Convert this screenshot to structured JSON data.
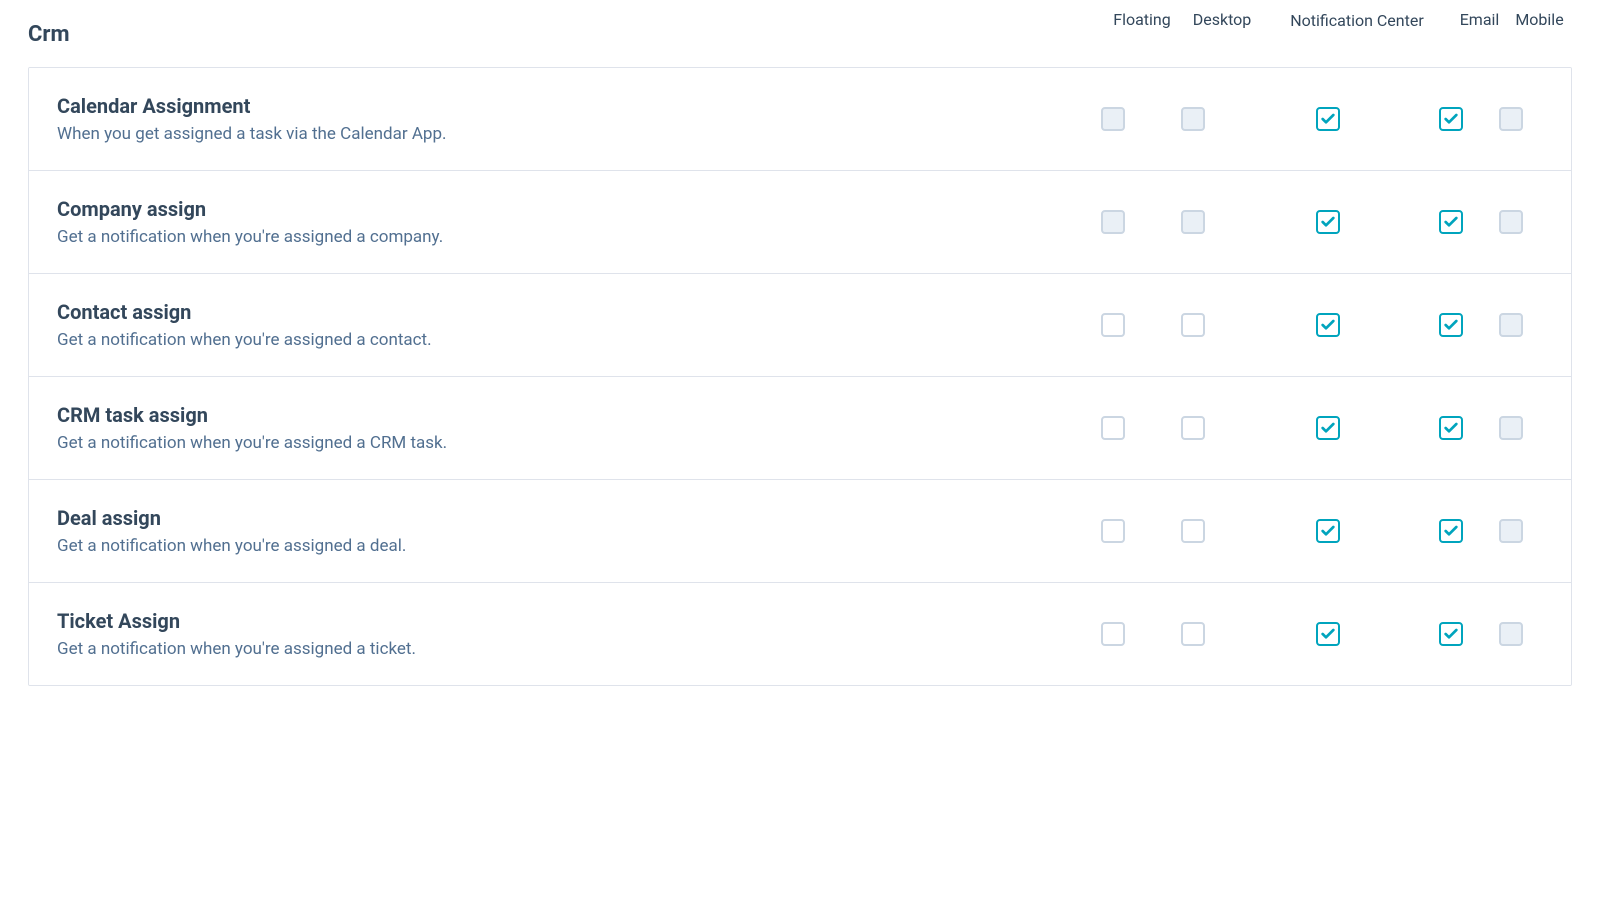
{
  "section": {
    "title": "Crm",
    "columns": {
      "floating": "Floating",
      "desktop": "Desktop",
      "notification_center": "Notification Center",
      "email": "Email",
      "mobile": "Mobile"
    },
    "rows": [
      {
        "title": "Calendar Assignment",
        "description": "When you get assigned a task via the Calendar App.",
        "checks": {
          "floating": {
            "checked": false,
            "disabled": true
          },
          "desktop": {
            "checked": false,
            "disabled": true
          },
          "notif": {
            "checked": true,
            "disabled": false
          },
          "email": {
            "checked": true,
            "disabled": false
          },
          "mobile": {
            "checked": false,
            "disabled": true
          }
        }
      },
      {
        "title": "Company assign",
        "description": "Get a notification when you're assigned a company.",
        "checks": {
          "floating": {
            "checked": false,
            "disabled": true
          },
          "desktop": {
            "checked": false,
            "disabled": true
          },
          "notif": {
            "checked": true,
            "disabled": false
          },
          "email": {
            "checked": true,
            "disabled": false
          },
          "mobile": {
            "checked": false,
            "disabled": true
          }
        }
      },
      {
        "title": "Contact assign",
        "description": "Get a notification when you're assigned a contact.",
        "checks": {
          "floating": {
            "checked": false,
            "disabled": false
          },
          "desktop": {
            "checked": false,
            "disabled": false
          },
          "notif": {
            "checked": true,
            "disabled": false
          },
          "email": {
            "checked": true,
            "disabled": false
          },
          "mobile": {
            "checked": false,
            "disabled": true
          }
        }
      },
      {
        "title": "CRM task assign",
        "description": "Get a notification when you're assigned a CRM task.",
        "checks": {
          "floating": {
            "checked": false,
            "disabled": false
          },
          "desktop": {
            "checked": false,
            "disabled": false
          },
          "notif": {
            "checked": true,
            "disabled": false
          },
          "email": {
            "checked": true,
            "disabled": false
          },
          "mobile": {
            "checked": false,
            "disabled": true
          }
        }
      },
      {
        "title": "Deal assign",
        "description": "Get a notification when you're assigned a deal.",
        "checks": {
          "floating": {
            "checked": false,
            "disabled": false
          },
          "desktop": {
            "checked": false,
            "disabled": false
          },
          "notif": {
            "checked": true,
            "disabled": false
          },
          "email": {
            "checked": true,
            "disabled": false
          },
          "mobile": {
            "checked": false,
            "disabled": true
          }
        }
      },
      {
        "title": "Ticket Assign",
        "description": "Get a notification when you're assigned a ticket.",
        "checks": {
          "floating": {
            "checked": false,
            "disabled": false
          },
          "desktop": {
            "checked": false,
            "disabled": false
          },
          "notif": {
            "checked": true,
            "disabled": false
          },
          "email": {
            "checked": true,
            "disabled": false
          },
          "mobile": {
            "checked": false,
            "disabled": true
          }
        }
      }
    ]
  }
}
